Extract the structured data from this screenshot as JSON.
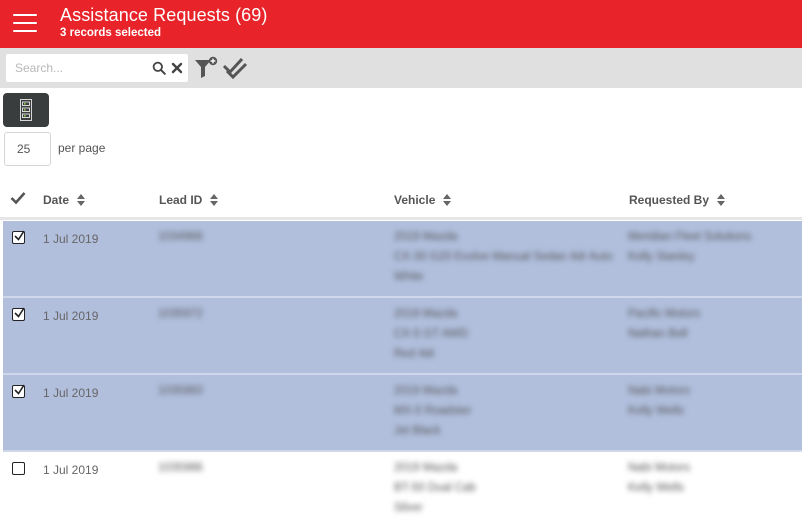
{
  "header": {
    "title": "Assistance Requests (69)",
    "subtitle": "3 records selected"
  },
  "toolbar": {
    "search_placeholder": "Search...",
    "icons": [
      "search-icon",
      "clear-icon",
      "filter-add-icon",
      "multi-check-icon"
    ]
  },
  "column_chooser": {
    "icon": "columns-list-icon"
  },
  "pagination": {
    "per_page_value": "25",
    "per_page_label": "per page"
  },
  "table": {
    "columns": [
      {
        "key": "date",
        "label": "Date"
      },
      {
        "key": "lead_id",
        "label": "Lead ID"
      },
      {
        "key": "vehicle",
        "label": "Vehicle"
      },
      {
        "key": "requested_by",
        "label": "Requested By"
      }
    ],
    "rows": [
      {
        "selected": true,
        "date": "1 Jul 2019",
        "lead_id": "1034968",
        "vehicle": [
          "2019 Mazda",
          "CX-30 G20 Evolve Manual Sedan 4dr Auto",
          "White"
        ],
        "requested_by": [
          "Meridian Fleet Solutions",
          "Kelly Stanley"
        ]
      },
      {
        "selected": true,
        "date": "1 Jul 2019",
        "lead_id": "1035972",
        "vehicle": [
          "2019 Mazda",
          "CX-5 GT AWD",
          "Red 4dr"
        ],
        "requested_by": [
          "Pacific Motors",
          "Nathan Bell"
        ]
      },
      {
        "selected": true,
        "date": "1 Jul 2019",
        "lead_id": "1035983",
        "vehicle": [
          "2019 Mazda",
          "MX-5 Roadster",
          "Jet Black"
        ],
        "requested_by": [
          "Nabi Motors",
          "Kelly Wells"
        ]
      },
      {
        "selected": false,
        "date": "1 Jul 2019",
        "lead_id": "1035986",
        "vehicle": [
          "2019 Mazda",
          "BT-50 Dual Cab",
          "Silver"
        ],
        "requested_by": [
          "Nabi Motors",
          "Kelly Wells"
        ]
      }
    ]
  }
}
